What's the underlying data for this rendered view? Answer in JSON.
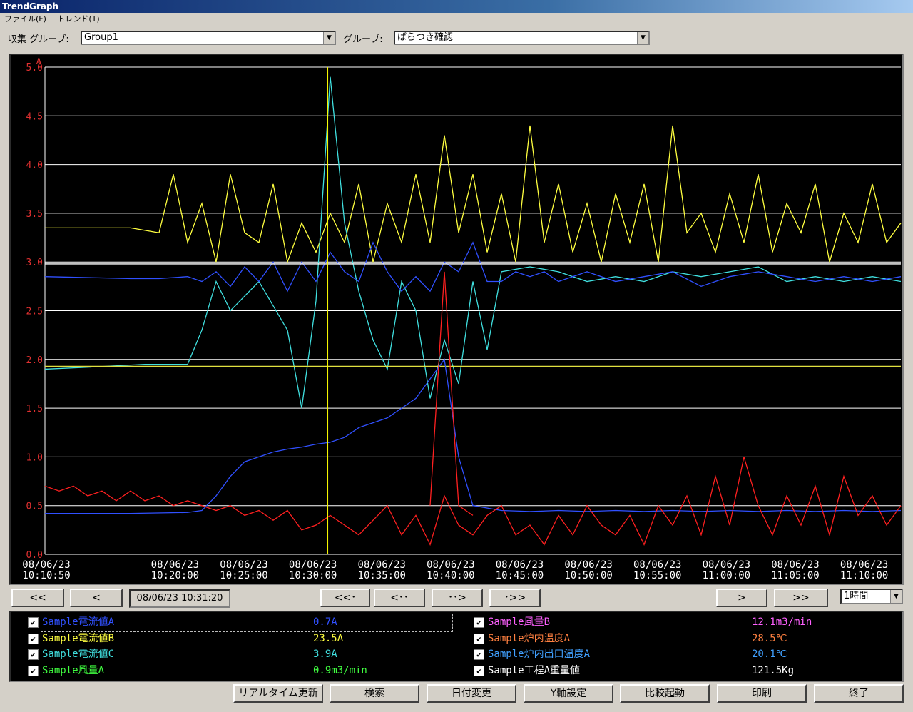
{
  "window": {
    "title": "TrendGraph"
  },
  "menu": [
    "ファイル(F)",
    "トレンド(T)"
  ],
  "toolbar": {
    "group_label": "収集 グループ:",
    "group_value": "Group1",
    "sub_label": "グループ:",
    "sub_value": "ばらつき確認"
  },
  "colors": {
    "grid": "#ffffff",
    "y_axis_text": "#e03030",
    "x_axis_text": "#ffffff",
    "cursor": "#ffff00"
  },
  "chart_data": {
    "type": "line",
    "ylabel": "A",
    "ylim": [
      0,
      5.0
    ],
    "yticks": [
      "0.0",
      "0.5",
      "1.0",
      "1.5",
      "2.0",
      "2.5",
      "3.0",
      "3.5",
      "4.0",
      "4.5",
      "5.0"
    ],
    "xticks": [
      {
        "date": "08/06/23",
        "time": "10:10:50"
      },
      {
        "date": "08/06/23",
        "time": "10:20:00"
      },
      {
        "date": "08/06/23",
        "time": "10:25:00"
      },
      {
        "date": "08/06/23",
        "time": "10:30:00"
      },
      {
        "date": "08/06/23",
        "time": "10:35:00"
      },
      {
        "date": "08/06/23",
        "time": "10:40:00"
      },
      {
        "date": "08/06/23",
        "time": "10:45:00"
      },
      {
        "date": "08/06/23",
        "time": "10:50:00"
      },
      {
        "date": "08/06/23",
        "time": "10:55:00"
      },
      {
        "date": "08/06/23",
        "time": "11:00:00"
      },
      {
        "date": "08/06/23",
        "time": "11:05:00"
      },
      {
        "date": "08/06/23",
        "time": "11:10:00"
      }
    ],
    "cursor_time": "10:31:20",
    "series": [
      {
        "color": "#ffff40",
        "x": [
          0,
          6,
          8,
          9,
          10,
          11,
          12,
          13,
          14,
          15,
          16,
          17,
          18,
          19,
          20,
          21,
          22,
          23,
          24,
          25,
          26,
          27,
          28,
          29,
          30,
          31,
          32,
          33,
          34,
          35,
          36,
          37,
          38,
          39,
          40,
          41,
          42,
          43,
          44,
          45,
          46,
          47,
          48,
          49,
          50,
          51,
          52,
          53,
          54,
          55,
          56,
          57,
          58,
          59,
          60
        ],
        "y": [
          3.35,
          3.35,
          3.3,
          3.9,
          3.2,
          3.6,
          3.0,
          3.9,
          3.3,
          3.2,
          3.8,
          3.0,
          3.4,
          3.1,
          3.5,
          3.2,
          3.8,
          3.0,
          3.6,
          3.2,
          3.9,
          3.2,
          4.3,
          3.3,
          3.9,
          3.1,
          3.7,
          3.0,
          4.4,
          3.2,
          3.8,
          3.1,
          3.6,
          3.0,
          3.7,
          3.2,
          3.8,
          3.0,
          4.4,
          3.3,
          3.5,
          3.1,
          3.7,
          3.2,
          3.9,
          3.1,
          3.6,
          3.3,
          3.8,
          3.0,
          3.5,
          3.2,
          3.8,
          3.2,
          3.4
        ]
      },
      {
        "color": "#40e0e0",
        "x": [
          0,
          3,
          7,
          10,
          11,
          12,
          13,
          15,
          17,
          18,
          19,
          20,
          21,
          22,
          23,
          24,
          25,
          26,
          27,
          28,
          29,
          30,
          31,
          32,
          34,
          36,
          38,
          40,
          42,
          44,
          46,
          48,
          50,
          52,
          54,
          56,
          58,
          60
        ],
        "y": [
          1.9,
          1.92,
          1.95,
          1.95,
          2.3,
          2.8,
          2.5,
          2.8,
          2.3,
          1.5,
          2.6,
          4.9,
          3.4,
          2.7,
          2.2,
          1.9,
          2.8,
          2.5,
          1.6,
          2.2,
          1.75,
          2.8,
          2.1,
          2.9,
          2.95,
          2.9,
          2.8,
          2.85,
          2.8,
          2.9,
          2.85,
          2.9,
          2.95,
          2.8,
          2.85,
          2.8,
          2.85,
          2.8
        ]
      },
      {
        "color": "#3050ff",
        "x": [
          0,
          6,
          8,
          10,
          11,
          12,
          13,
          14,
          15,
          16,
          17,
          18,
          19,
          20,
          21,
          22,
          23,
          24,
          25,
          26,
          27,
          28,
          29,
          30,
          31,
          32,
          33,
          34,
          35,
          36,
          38,
          40,
          42,
          44,
          46,
          48,
          50,
          52,
          54,
          56,
          58,
          60
        ],
        "y": [
          2.85,
          2.83,
          2.83,
          2.85,
          2.8,
          2.9,
          2.75,
          2.95,
          2.8,
          3.0,
          2.7,
          3.0,
          2.8,
          3.1,
          2.9,
          2.8,
          3.2,
          2.9,
          2.7,
          2.85,
          2.7,
          3.0,
          2.9,
          3.2,
          2.8,
          2.8,
          2.9,
          2.85,
          2.9,
          2.8,
          2.9,
          2.8,
          2.85,
          2.9,
          2.75,
          2.85,
          2.9,
          2.85,
          2.8,
          2.85,
          2.8,
          2.85
        ]
      },
      {
        "color": "#ffffff",
        "x": [
          0,
          10,
          20,
          30,
          40,
          50,
          60
        ],
        "y": [
          2.98,
          2.98,
          2.98,
          2.98,
          2.98,
          2.98,
          2.98
        ]
      },
      {
        "color": "#e0e040",
        "x": [
          0,
          10,
          20,
          30,
          40,
          50,
          60
        ],
        "y": [
          1.93,
          1.93,
          1.93,
          1.93,
          1.93,
          1.93,
          1.93
        ]
      },
      {
        "color": "#3050ff",
        "x": [
          0,
          6,
          10,
          11,
          12,
          13,
          14,
          15,
          16,
          17,
          18,
          19,
          20,
          21,
          22,
          23,
          24,
          25,
          26,
          27,
          28,
          29,
          30,
          32,
          34,
          36,
          38,
          40,
          42,
          44,
          46,
          48,
          50,
          52,
          54,
          56,
          58,
          60
        ],
        "y": [
          0.42,
          0.42,
          0.43,
          0.45,
          0.6,
          0.8,
          0.95,
          1.0,
          1.05,
          1.08,
          1.1,
          1.13,
          1.15,
          1.2,
          1.3,
          1.35,
          1.4,
          1.5,
          1.6,
          1.8,
          2.0,
          1.0,
          0.5,
          0.45,
          0.44,
          0.45,
          0.44,
          0.45,
          0.44,
          0.45,
          0.44,
          0.45,
          0.44,
          0.45,
          0.44,
          0.45,
          0.44,
          0.45
        ]
      },
      {
        "color": "#ff2020",
        "x": [
          0,
          1,
          2,
          3,
          4,
          5,
          6,
          7,
          8,
          9,
          10,
          11,
          12,
          13,
          14,
          15,
          16,
          17,
          18,
          19,
          20,
          21,
          22,
          23,
          24,
          25,
          26,
          27,
          28,
          29,
          30,
          31,
          32,
          33,
          34,
          35,
          36,
          37,
          38,
          39,
          40,
          41,
          42,
          43,
          44,
          45,
          46,
          47,
          48,
          49,
          50,
          51,
          52,
          53,
          54,
          55,
          56,
          57,
          58,
          59,
          60
        ],
        "y": [
          0.7,
          0.65,
          0.7,
          0.6,
          0.65,
          0.55,
          0.65,
          0.55,
          0.6,
          0.5,
          0.55,
          0.5,
          0.45,
          0.5,
          0.4,
          0.45,
          0.35,
          0.45,
          0.25,
          0.3,
          0.4,
          0.3,
          0.2,
          0.35,
          0.5,
          0.2,
          0.4,
          0.1,
          0.6,
          0.3,
          0.2,
          0.4,
          0.5,
          0.2,
          0.3,
          0.1,
          0.4,
          0.2,
          0.5,
          0.3,
          0.2,
          0.4,
          0.1,
          0.5,
          0.3,
          0.6,
          0.2,
          0.8,
          0.3,
          1.0,
          0.5,
          0.2,
          0.6,
          0.3,
          0.7,
          0.2,
          0.8,
          0.4,
          0.6,
          0.3,
          0.5
        ]
      },
      {
        "color": "#ff2020",
        "x": [
          27,
          28,
          29,
          30
        ],
        "y": [
          0.5,
          2.9,
          0.5,
          0.4
        ]
      }
    ]
  },
  "nav": {
    "first": "<<",
    "prev": "<",
    "date": "08/06/23 10:31:20",
    "scroll_far_left": "<<･",
    "scroll_left": "<･･",
    "scroll_right": "･･>",
    "scroll_far_right": "･>>",
    "next": ">",
    "last": ">>",
    "range": "1時間"
  },
  "legend": [
    {
      "name": "Sample電流値A",
      "value": "0.7A",
      "color": "#3050ff"
    },
    {
      "name": "Sample電流値B",
      "value": "23.5A",
      "color": "#ffff40"
    },
    {
      "name": "Sample電流値C",
      "value": "3.9A",
      "color": "#40e0e0"
    },
    {
      "name": "Sample風量A",
      "value": "0.9m3/min",
      "color": "#40ff40"
    },
    {
      "name": "Sample風量B",
      "value": "12.1m3/min",
      "color": "#ff60ff"
    },
    {
      "name": "Sample炉内温度A",
      "value": "28.5℃",
      "color": "#ff8040"
    },
    {
      "name": "Sample炉内出口温度A",
      "value": "20.1℃",
      "color": "#40a0ff"
    },
    {
      "name": "Sample工程A重量値",
      "value": "121.5Kg",
      "color": "#ffffff"
    }
  ],
  "buttons": [
    "リアルタイム更新",
    "検索",
    "日付変更",
    "Y軸設定",
    "比較起動",
    "印刷",
    "終了"
  ]
}
